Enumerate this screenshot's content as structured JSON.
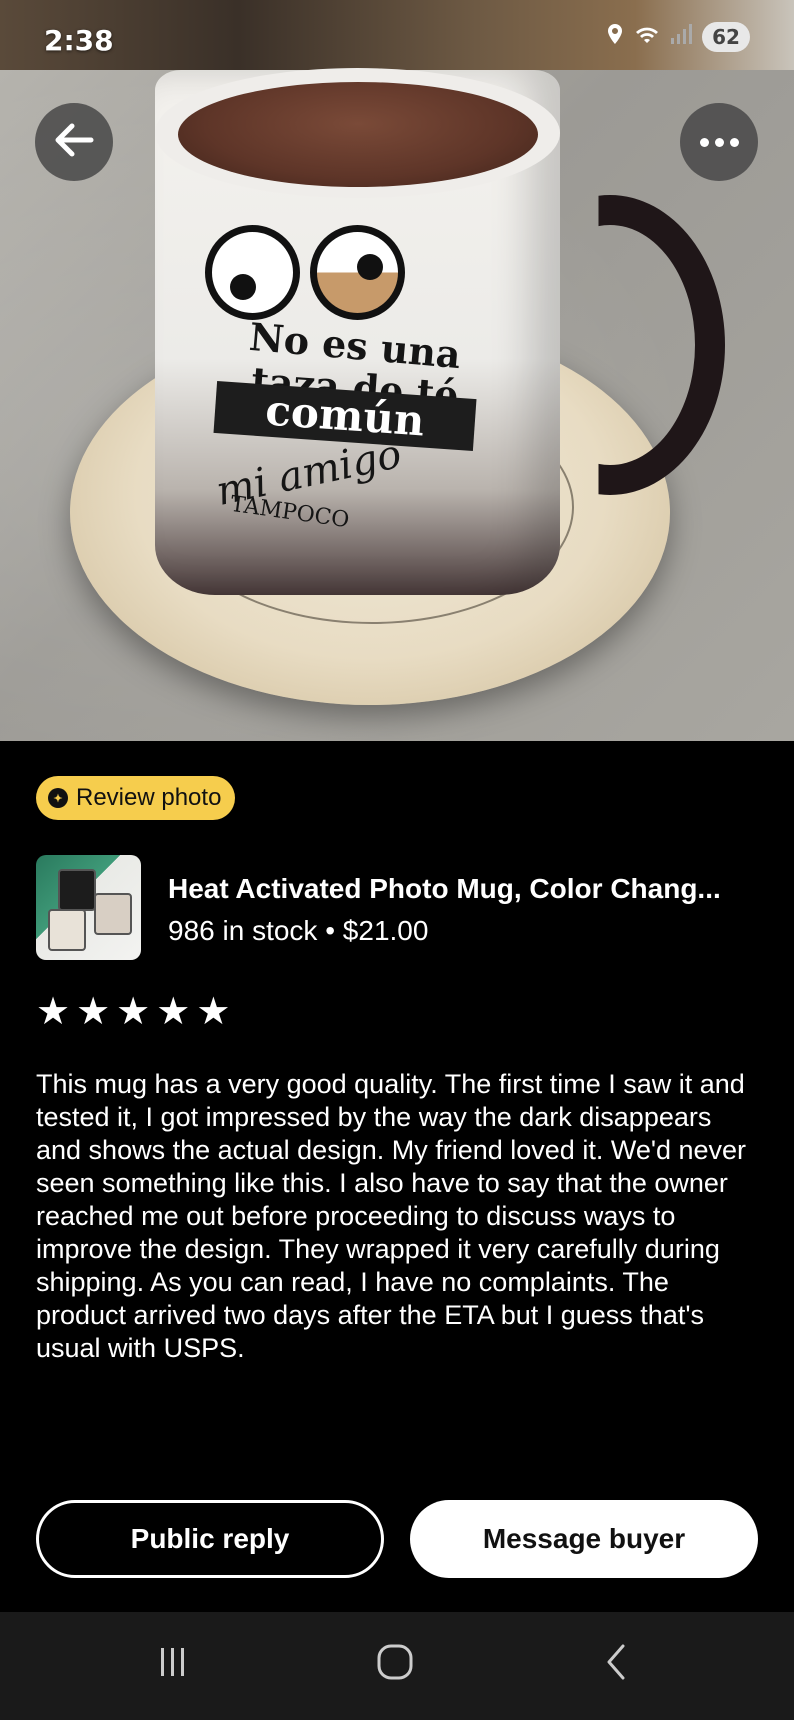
{
  "status_bar": {
    "time": "2:38",
    "battery": "62",
    "icons": [
      "location-icon",
      "wifi-icon",
      "signal-icon"
    ]
  },
  "photo": {
    "alt": "Review photo of a white mug of tea on a saucer",
    "mug_text": {
      "line1": "No es una",
      "line2": "taza de té",
      "line3": "común",
      "line4": "mi amigo",
      "line5": "TAMPOCO"
    }
  },
  "toolbar": {
    "back_icon": "arrow-left-icon",
    "more_icon": "more-horizontal-icon"
  },
  "badge": {
    "label": "Review photo"
  },
  "product": {
    "title": "Heat Activated Photo Mug, Color Chang...",
    "stock": "986 in stock",
    "separator": "•",
    "price": "$21.00"
  },
  "rating": {
    "value": 5,
    "max": 5
  },
  "review": {
    "text": "This mug has a very good quality. The first time I saw it and tested it, I got impressed by the way the dark disappears and shows the actual design. My friend loved it. We'd never seen something like this. I also have to say that the owner reached me out before proceeding to discuss ways to improve the design. They wrapped it very carefully during shipping. As you can read, I have no complaints. The product arrived two days after the ETA but I guess that's usual with USPS."
  },
  "actions": {
    "public_reply": "Public reply",
    "message_buyer": "Message buyer"
  },
  "colors": {
    "badge_bg": "#f6cd4d",
    "background": "#000000",
    "nav_bg": "#1a1a1a"
  }
}
